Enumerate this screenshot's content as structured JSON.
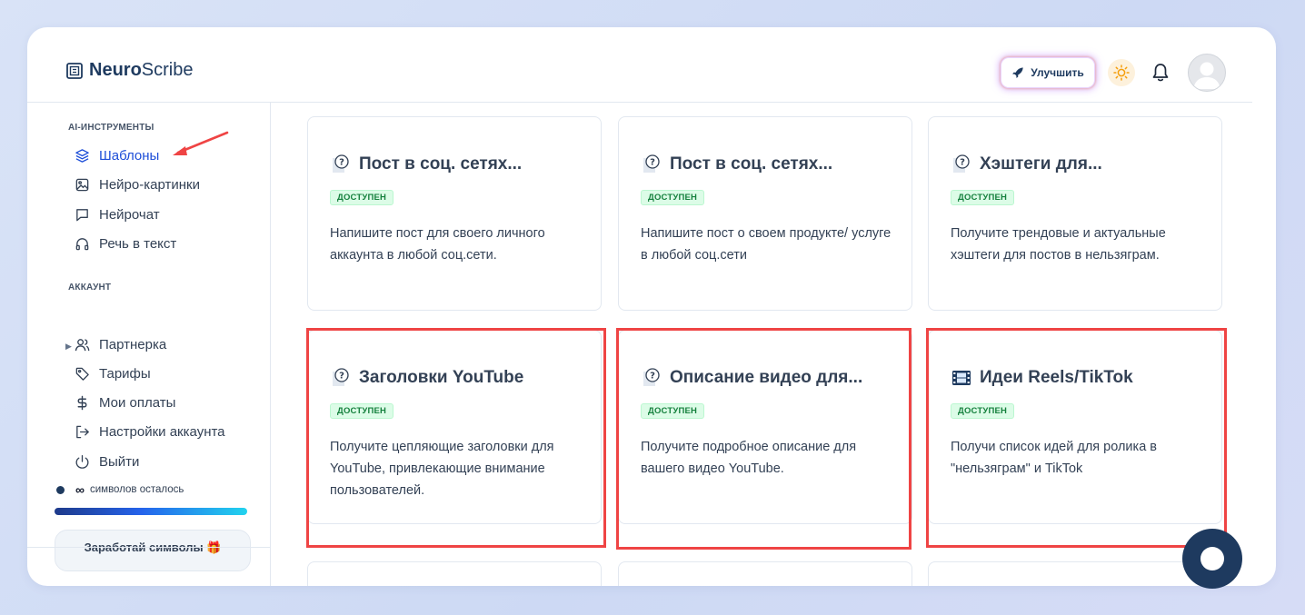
{
  "app": {
    "logo_bold": "Neuro",
    "logo_light": "Scribe"
  },
  "header": {
    "upgrade_label": "Улучшить"
  },
  "sidebar": {
    "ai_section": "AI-ИНСТРУМЕНТЫ",
    "ai_items": [
      {
        "label": "Шаблоны",
        "icon": "layers-icon",
        "active": true
      },
      {
        "label": "Нейро-картинки",
        "icon": "image-icon"
      },
      {
        "label": "Нейрочат",
        "icon": "chat-icon"
      },
      {
        "label": "Речь в текст",
        "icon": "headphones-icon"
      }
    ],
    "account_section": "АККАУНТ",
    "account_items": [
      {
        "label": "Партнерка",
        "icon": "users-icon"
      },
      {
        "label": "Тарифы",
        "icon": "tag-icon"
      },
      {
        "label": "Мои оплаты",
        "icon": "dollar-icon"
      },
      {
        "label": "Настройки аккаунта",
        "icon": "logout-arrow-icon"
      },
      {
        "label": "Выйти",
        "icon": "power-icon"
      }
    ],
    "symbols_value": "∞",
    "symbols_label": "символов осталось",
    "symbols_progress": 1.0,
    "earn_button": "Заработай символы 🎁"
  },
  "cards": [
    {
      "title": "Пост в соц. сетях...",
      "badge": "ДОСТУПЕН",
      "desc": "Напишите пост для своего личного аккаунта в любой соц.сети.",
      "icon": "question-doc-icon"
    },
    {
      "title": "Пост в соц. сетях...",
      "badge": "ДОСТУПЕН",
      "desc": "Напишите пост о своем продукте/ услуге в любой соц.сети",
      "icon": "question-doc-icon"
    },
    {
      "title": "Хэштеги для...",
      "badge": "ДОСТУПЕН",
      "desc": "Получите трендовые и актуальные хэштеги для постов в нельзяграм.",
      "icon": "question-doc-icon"
    },
    {
      "title": "Заголовки YouTube",
      "badge": "ДОСТУПЕН",
      "desc": "Получите цепляющие заголовки для YouTube, привлекающие внимание пользователей.",
      "icon": "question-doc-icon"
    },
    {
      "title": "Описание видео для...",
      "badge": "ДОСТУПЕН",
      "desc": "Получите подробное описание для вашего видео YouTube.",
      "icon": "question-doc-icon"
    },
    {
      "title": "Идеи Reels/TikTok",
      "badge": "ДОСТУПЕН",
      "desc": "Получи список идей для ролика в \"нельзяграм\" и TikTok",
      "icon": "film-icon"
    }
  ],
  "colors": {
    "accent": "#1d4ed8",
    "highlight": "#ef4444",
    "badge_bg": "#dcfce7",
    "badge_text": "#15803d"
  }
}
